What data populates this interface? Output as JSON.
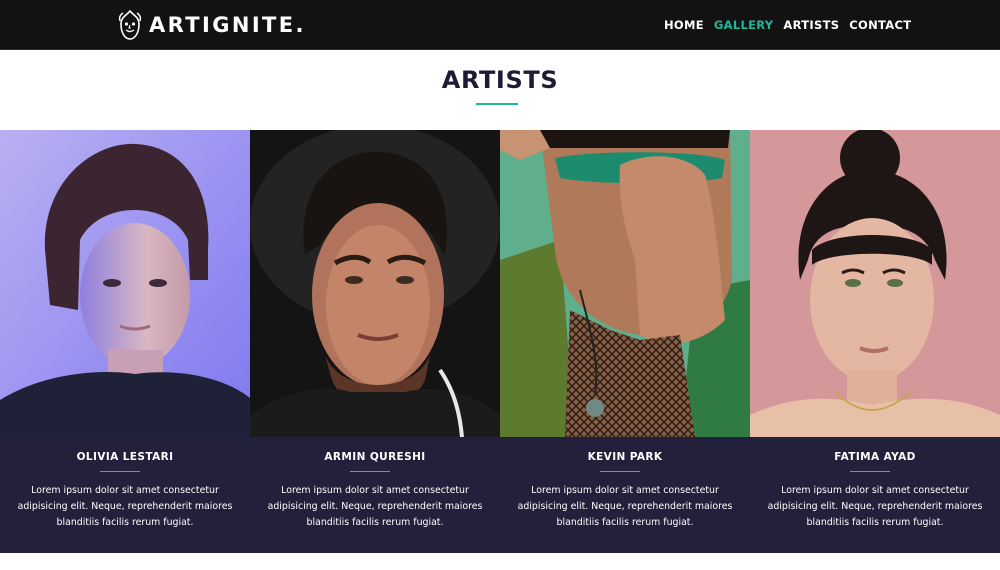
{
  "brand": {
    "name": "ARTIGNITE.",
    "logo_icon": "flame-face-logo-icon"
  },
  "nav": {
    "items": [
      {
        "label": "HOME",
        "active": false
      },
      {
        "label": "GALLERY",
        "active": true
      },
      {
        "label": "ARTISTS",
        "active": false
      },
      {
        "label": "CONTACT",
        "active": false
      }
    ]
  },
  "page": {
    "title": "ARTISTS"
  },
  "artists": [
    {
      "name": "OLIVIA LESTARI",
      "description": "Lorem ipsum dolor sit amet consectetur adipisicing elit. Neque, reprehenderit maiores blanditiis facilis rerum fugiat."
    },
    {
      "name": "ARMIN QURESHI",
      "description": "Lorem ipsum dolor sit amet consectetur adipisicing elit. Neque, reprehenderit maiores blanditiis facilis rerum fugiat."
    },
    {
      "name": "KEVIN PARK",
      "description": "Lorem ipsum dolor sit amet consectetur adipisicing elit. Neque, reprehenderit maiores blanditiis facilis rerum fugiat."
    },
    {
      "name": "FATIMA AYAD",
      "description": "Lorem ipsum dolor sit amet consectetur adipisicing elit. Neque, reprehenderit maiores blanditiis facilis rerum fugiat."
    }
  ],
  "colors": {
    "accent": "#1fb89a",
    "navbar": "#121212",
    "card_info": "#22203a",
    "title": "#1e1c34"
  }
}
